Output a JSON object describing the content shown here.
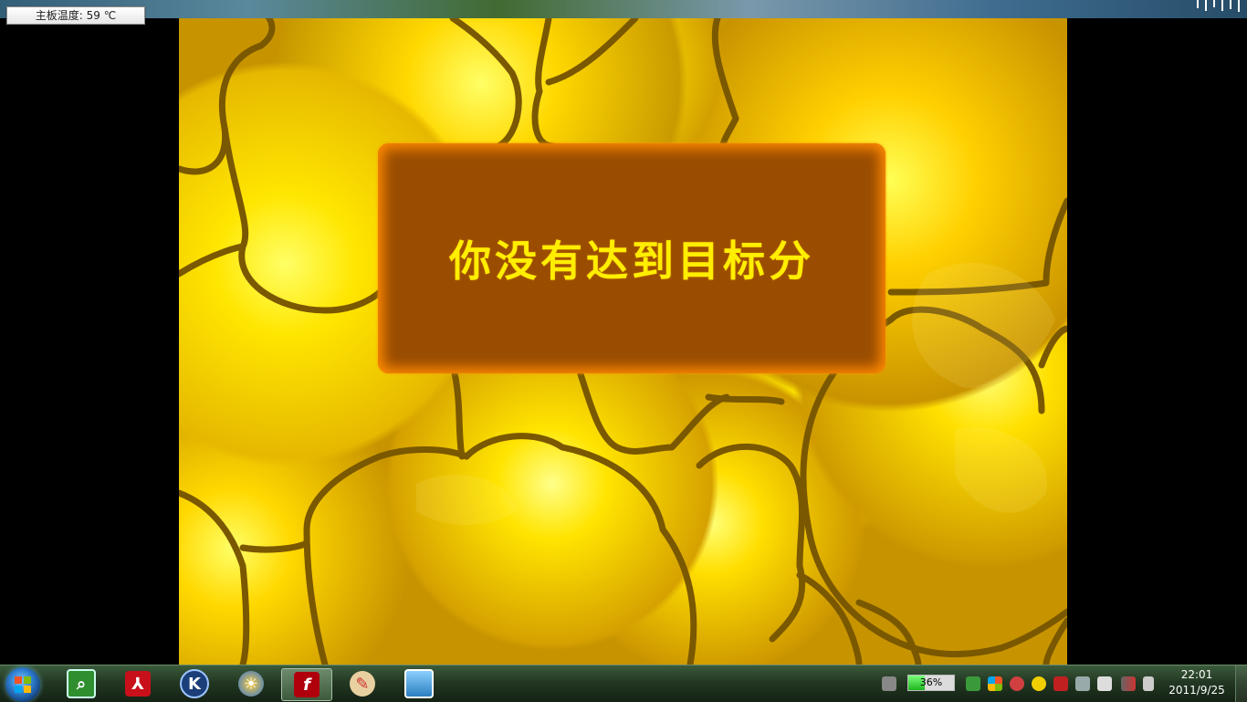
{
  "desktop": {
    "tooltip": "主板温度: 59 ℃"
  },
  "game": {
    "message": "你没有达到目标分",
    "colors": {
      "panel": "#9a4d00",
      "panel_glow": "#ff8a00",
      "text": "#ffee00",
      "blob_outline": "#7a5800"
    }
  },
  "taskbar": {
    "start_icon": "windows-logo-icon",
    "pinned": [
      {
        "name": "monitor-magnifier-icon"
      },
      {
        "name": "pdf-reader-icon"
      },
      {
        "name": "k-app-icon"
      },
      {
        "name": "sun-settings-icon"
      },
      {
        "name": "flash-player-icon",
        "active": true
      },
      {
        "name": "paint-palette-icon"
      },
      {
        "name": "image-viewer-icon"
      }
    ],
    "tray": {
      "battery_percent": "36%",
      "battery_level": 0.36,
      "icons": [
        "keyboard-icon",
        "search-monitor-icon",
        "windows-flag-icon",
        "security-cam-icon",
        "plus-shield-icon",
        "shield-icon",
        "usb-device-icon",
        "flash-drive-icon",
        "network-icon",
        "volume-icon"
      ]
    },
    "clock": {
      "time": "22:01",
      "date": "2011/9/25"
    }
  }
}
